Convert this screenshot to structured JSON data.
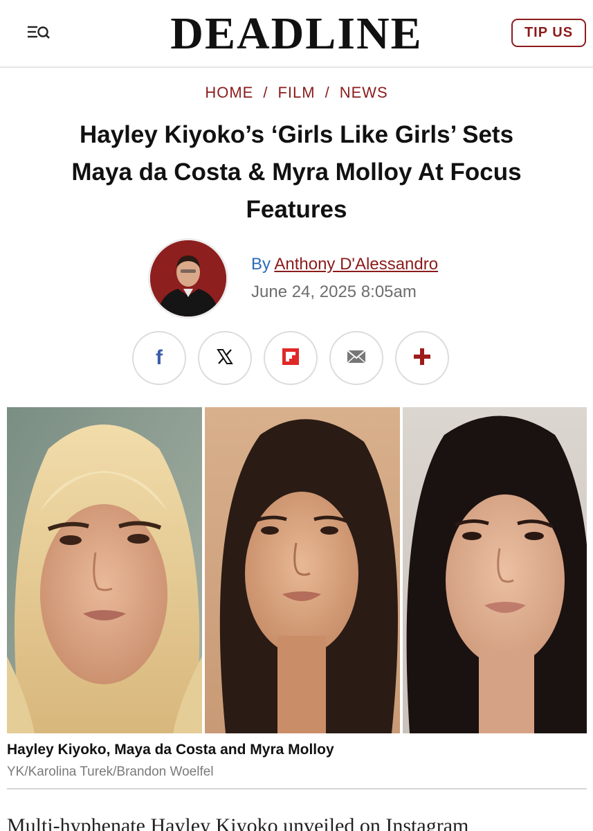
{
  "header": {
    "logo": "DEADLINE",
    "tip_label": "TIP US"
  },
  "breadcrumb": {
    "items": [
      "HOME",
      "FILM",
      "NEWS"
    ],
    "separator": "/"
  },
  "article": {
    "headline_lines": [
      "Hayley Kiyoko’s ‘Girls Like Girls’ Sets",
      "Maya da Costa & Myra Molloy At Focus",
      "Features"
    ],
    "by_prefix": "By",
    "author": "Anthony D'Alessandro",
    "date": "June 24, 2025 8:05am"
  },
  "share": {
    "icons": [
      "facebook-icon",
      "x-icon",
      "flipboard-icon",
      "email-icon",
      "plus-icon"
    ],
    "facebook_glyph": "f"
  },
  "photo": {
    "caption": "Hayley Kiyoko, Maya da Costa and Myra Molloy",
    "credit": "YK/Karolina Turek/Brandon Woelfel"
  },
  "body_preview": "Multi-hyphenate Hayley Kiyoko unveiled on Instagram",
  "colors": {
    "brand_red": "#8b1b1b",
    "byline_blue": "#2a6bb5",
    "flipboard_red": "#e12828"
  }
}
